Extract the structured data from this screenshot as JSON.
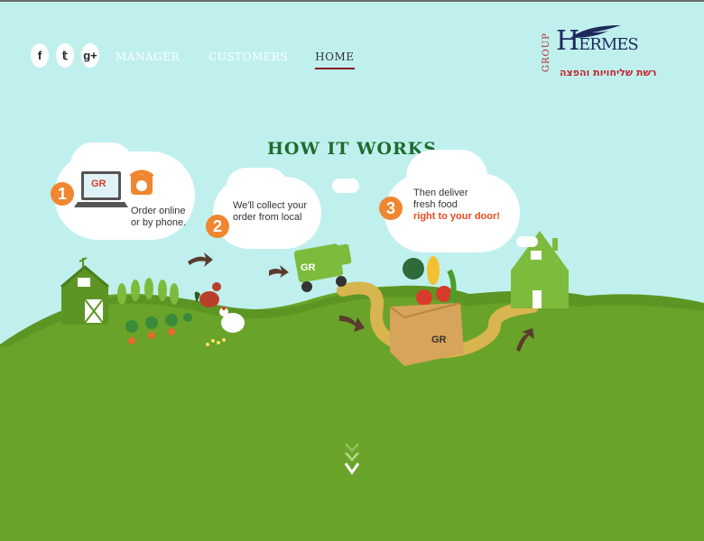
{
  "social": [
    {
      "name": "facebook",
      "glyph": "f"
    },
    {
      "name": "twitter",
      "glyph": "𝕥"
    },
    {
      "name": "google-plus",
      "glyph": "g+"
    }
  ],
  "nav": {
    "manager": "MANAGER",
    "customers": "CUSTOMERS",
    "home": "HOME"
  },
  "logo": {
    "group": "GROUP",
    "hermes_h": "H",
    "hermes_rest": "ERMES",
    "hebrew": "רשת שליחויות והפצה"
  },
  "title": "HOW IT WORKS",
  "steps": [
    {
      "num": "1",
      "line1": "Order online",
      "line2": "or by phone.",
      "badge": "GR"
    },
    {
      "num": "2",
      "line1": "We'll collect your",
      "line2": "order from local"
    },
    {
      "num": "3",
      "line1": "Then deliver",
      "line2": "fresh food",
      "line3": "right to your door!"
    }
  ],
  "illustration": {
    "truck_label": "GR",
    "box_label": "GR"
  },
  "colors": {
    "sky": "#bff0ee",
    "grass": "#6aa329",
    "grass_dark": "#5d9524",
    "path": "#d8b54f",
    "orange": "#f0862f"
  }
}
